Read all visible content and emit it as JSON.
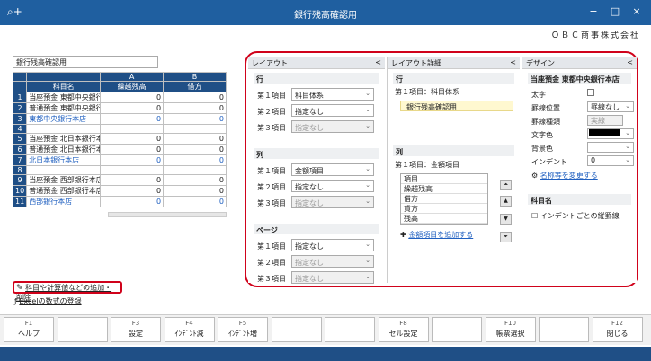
{
  "window": {
    "title": "銀行残高確認用",
    "icon": "search-plus-icon",
    "controls": [
      "−",
      "□",
      "×"
    ]
  },
  "company": "ＯＢＣ商事株式会社",
  "doc_name": "銀行残高確認用",
  "grid": {
    "col_letters": [
      "A",
      "B"
    ],
    "headers": [
      "科目名",
      "繰越残高",
      "借方"
    ],
    "rows": [
      {
        "no": "1",
        "name": "当座預金 東都中央銀行",
        "a": "0",
        "b": "0",
        "blue": false
      },
      {
        "no": "2",
        "name": "普通預金 東都中央銀行",
        "a": "0",
        "b": "0",
        "blue": false
      },
      {
        "no": "3",
        "name": "東都中央銀行本店",
        "a": "0",
        "b": "0",
        "blue": true
      },
      {
        "no": "4",
        "name": "",
        "a": "",
        "b": "",
        "blue": false
      },
      {
        "no": "5",
        "name": "当座預金 北日本銀行本",
        "a": "0",
        "b": "0",
        "blue": false
      },
      {
        "no": "6",
        "name": "普通預金 北日本銀行本",
        "a": "0",
        "b": "0",
        "blue": false
      },
      {
        "no": "7",
        "name": "北日本銀行本店",
        "a": "0",
        "b": "0",
        "blue": true
      },
      {
        "no": "8",
        "name": "",
        "a": "",
        "b": "",
        "blue": false
      },
      {
        "no": "9",
        "name": "当座預金 西部銀行本店",
        "a": "0",
        "b": "0",
        "blue": false
      },
      {
        "no": "10",
        "name": "普通預金 西部銀行本店",
        "a": "0",
        "b": "0",
        "blue": false
      },
      {
        "no": "11",
        "name": "西部銀行本店",
        "a": "0",
        "b": "0",
        "blue": true
      }
    ]
  },
  "links": {
    "add_items": "科目や計算値などの追加・削除",
    "excel": "Excelの数式の登録"
  },
  "layout_panel": {
    "title": "レイアウト",
    "sections": [
      {
        "title": "行",
        "rows": [
          {
            "label": "第１項目",
            "value": "科目体系",
            "disabled": false
          },
          {
            "label": "第２項目",
            "value": "指定なし",
            "disabled": false
          },
          {
            "label": "第３項目",
            "value": "指定なし",
            "disabled": true
          }
        ]
      },
      {
        "title": "列",
        "rows": [
          {
            "label": "第１項目",
            "value": "金額項目",
            "disabled": false
          },
          {
            "label": "第２項目",
            "value": "指定なし",
            "disabled": false
          },
          {
            "label": "第３項目",
            "value": "指定なし",
            "disabled": true
          }
        ]
      },
      {
        "title": "ページ",
        "rows": [
          {
            "label": "第１項目",
            "value": "指定なし",
            "disabled": false
          },
          {
            "label": "第２項目",
            "value": "指定なし",
            "disabled": true
          },
          {
            "label": "第３項目",
            "value": "指定なし",
            "disabled": true
          }
        ]
      }
    ]
  },
  "detail_panel": {
    "title": "レイアウト詳細",
    "row_section": "行",
    "row_item": "第１項目：科目体系",
    "row_value": "銀行残高確認用",
    "col_section": "列",
    "col_item": "第１項目：金額項目",
    "list": [
      "項目",
      "繰越残高",
      "借方",
      "貸方",
      "残高"
    ],
    "add_link": "金額項目を追加する"
  },
  "design_panel": {
    "title": "デザイン",
    "subject": "当座預金 東都中央銀行本店",
    "bold": "太字",
    "border_pos": "罫線位置",
    "border_pos_value": "罫線なし",
    "border_type": "罫線種類",
    "border_type_value": "実線",
    "text_color": "文字色",
    "bg_color": "背景色",
    "indent": "インデント",
    "indent_value": "0",
    "rename_link": "名称等を変更する",
    "section2": "科目名",
    "vertical_indent": "インデントごとの縦罫線"
  },
  "fkeys": [
    {
      "key": "F1",
      "label": "ヘルプ"
    },
    {
      "key": "",
      "label": ""
    },
    {
      "key": "F3",
      "label": "設定"
    },
    {
      "key": "F4",
      "label": "ｲﾝﾃﾞﾝﾄ減"
    },
    {
      "key": "F5",
      "label": "ｲﾝﾃﾞﾝﾄ増"
    },
    {
      "key": "",
      "label": ""
    },
    {
      "key": "",
      "label": ""
    },
    {
      "key": "F8",
      "label": "セル設定"
    },
    {
      "key": "",
      "label": ""
    },
    {
      "key": "F10",
      "label": "帳票選択"
    },
    {
      "key": "",
      "label": ""
    },
    {
      "key": "F12",
      "label": "閉じる"
    }
  ]
}
